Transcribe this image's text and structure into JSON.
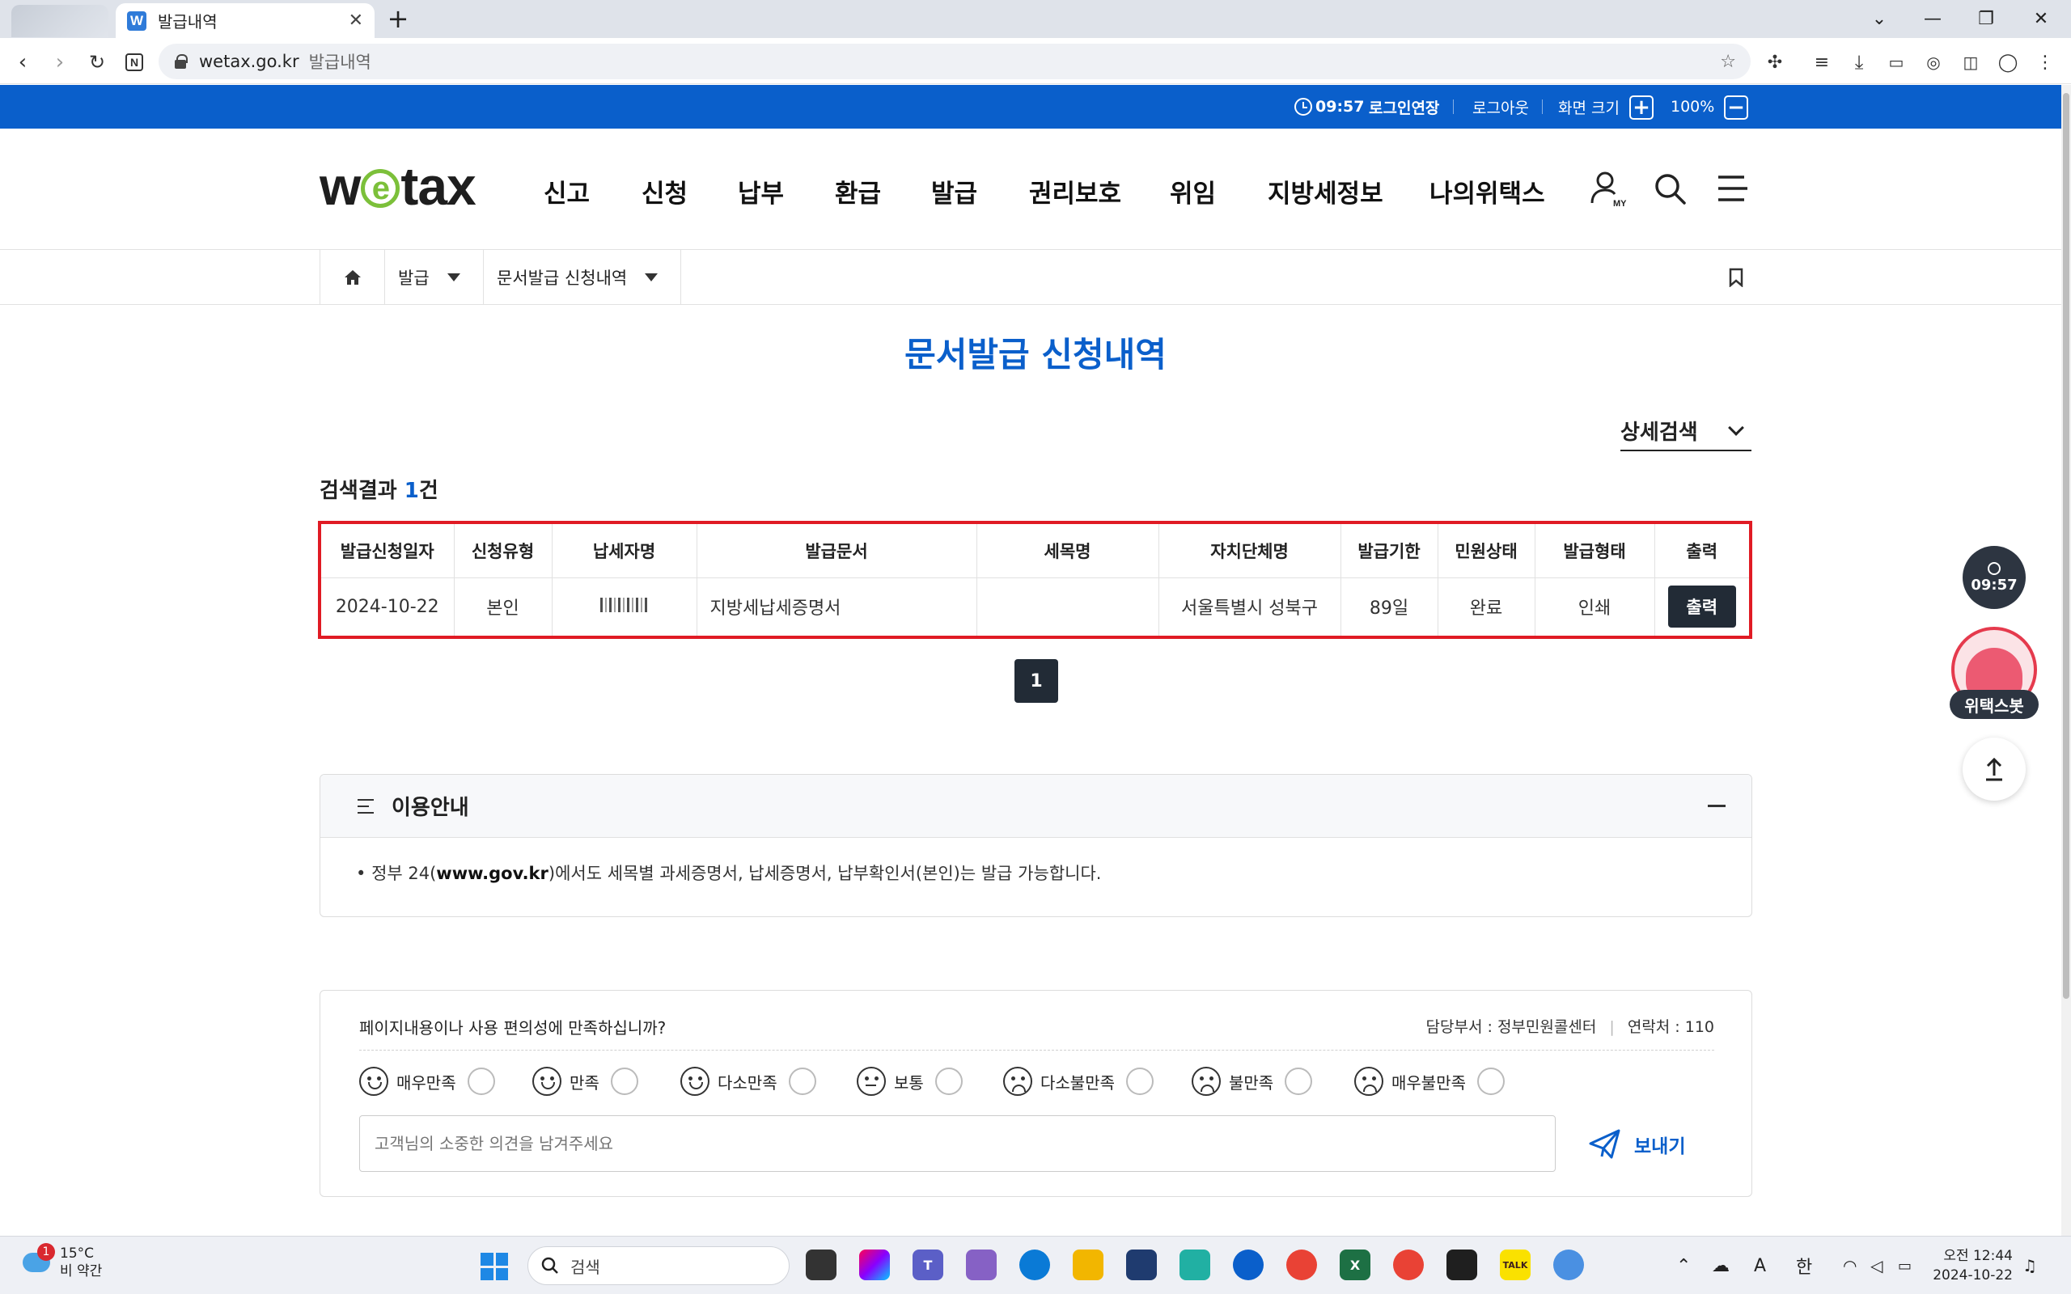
{
  "browser": {
    "tab_title": "발급내역",
    "favicon_letter": "W",
    "url_host": "wetax.go.kr",
    "url_title": "발급내역"
  },
  "utilbar": {
    "timer": "09:57",
    "extend_login": "로그인연장",
    "logout": "로그아웃",
    "screen_size": "화면 크기",
    "zoom_in": "+",
    "zoom": "100%",
    "zoom_out": "−"
  },
  "header": {
    "logo_w": "w",
    "logo_e": "e",
    "logo_rest": "tax",
    "nav": [
      "신고",
      "신청",
      "납부",
      "환급",
      "발급",
      "권리보호",
      "위임",
      "지방세정보",
      "나의위택스"
    ],
    "my_label": "MY"
  },
  "breadcrumb": {
    "level1": "발급",
    "level2": "문서발급 신청내역"
  },
  "main": {
    "title": "문서발급 신청내역",
    "detail_search": "상세검색",
    "result_prefix": "검색결과 ",
    "result_count": "1",
    "result_suffix": "건",
    "table": {
      "headers": [
        "발급신청일자",
        "신청유형",
        "납세자명",
        "발급문서",
        "세목명",
        "자치단체명",
        "발급기한",
        "민원상태",
        "발급형태",
        "출력"
      ],
      "rows": [
        {
          "date": "2024-10-22",
          "type": "본인",
          "name_masked": true,
          "document": "지방세납세증명서",
          "tax_item": "",
          "municipality": "서울특별시 성북구",
          "deadline": "89일",
          "status": "완료",
          "form": "인쇄",
          "print_label": "출력"
        }
      ]
    },
    "page": "1"
  },
  "guide": {
    "title": "이용안내",
    "text_pre": "정부 24(",
    "text_bold": "www.gov.kr",
    "text_post": ")에서도 세목별 과세증명서, 납세증명서, 납부확인서(본인)는 발급 가능합니다."
  },
  "survey": {
    "question": "페이지내용이나 사용 편의성에 만족하십니까?",
    "dept": "담당부서 : 정부민원콜센터",
    "contact": "연락처 : 110",
    "options": [
      "매우만족",
      "만족",
      "다소만족",
      "보통",
      "다소불만족",
      "불만족",
      "매우불만족"
    ],
    "placeholder": "고객님의 소중한 의견을 남겨주세요",
    "send": "보내기"
  },
  "floating": {
    "timer": "09:57",
    "bot_label": "위택스봇"
  },
  "taskbar": {
    "badge": "1",
    "temp": "15°C",
    "weather": "비 약간",
    "search": "검색",
    "ime_a": "A",
    "ime_lang": "한",
    "time": "오전 12:44",
    "date": "2024-10-22"
  },
  "colors": {
    "brand_blue": "#0a5fcb",
    "highlight_red": "#e01b24",
    "dark_button": "#222b36",
    "logo_green": "#7cc03a"
  }
}
